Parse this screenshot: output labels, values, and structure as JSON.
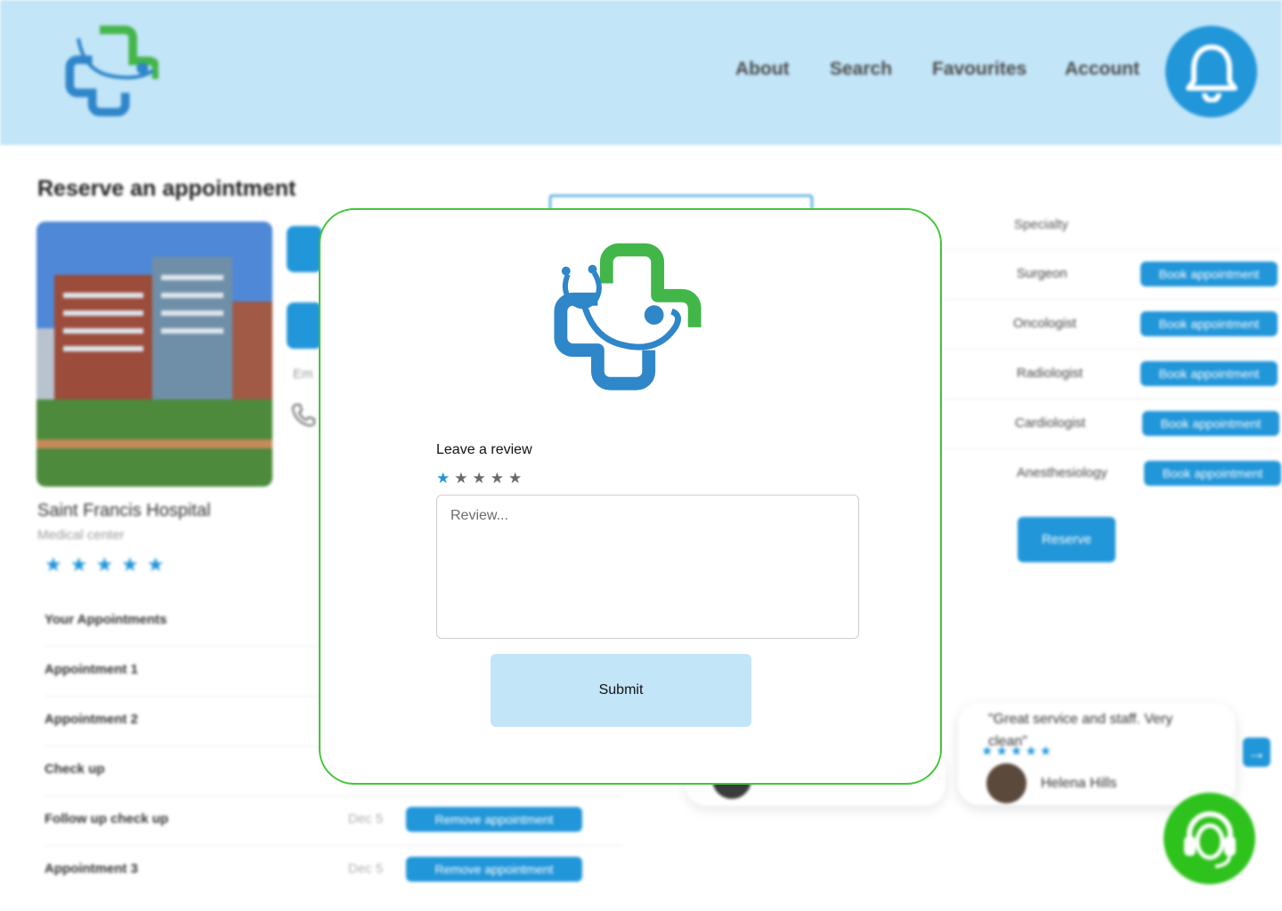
{
  "nav": {
    "links": [
      "About",
      "Search",
      "Favourites",
      "Account"
    ]
  },
  "page": {
    "title": "Reserve an appointment"
  },
  "hospital": {
    "name": "Saint Francis Hospital",
    "type": "Medical center",
    "rating": 4.5,
    "stars": "★★★★★"
  },
  "appointments": {
    "header": "Your Appointments",
    "rows": [
      {
        "label": "Appointment 1",
        "date": "",
        "action": ""
      },
      {
        "label": "Appointment 2",
        "date": "",
        "action": ""
      },
      {
        "label": "Check up",
        "date": "",
        "action": ""
      },
      {
        "label": "Follow up check up",
        "date": "Dec 5",
        "action": "Remove appointment"
      },
      {
        "label": "Appointment 3",
        "date": "Dec 5",
        "action": "Remove appointment"
      }
    ]
  },
  "contact": {
    "email_label": "Em"
  },
  "specialties": {
    "header": "Specialty",
    "rows": [
      {
        "label": "Surgeon",
        "action": "Book appointment"
      },
      {
        "label": "Oncologist",
        "action": "Book appointment"
      },
      {
        "label": "Radiologist",
        "action": "Book appointment"
      },
      {
        "label": "Cardiologist",
        "action": "Book appointment"
      },
      {
        "label": "Anesthesiology",
        "action": "Book appointment"
      }
    ],
    "reserve_label": "Reserve"
  },
  "testimonial": {
    "quote": "\"Great service and staff. Very clean\"",
    "stars": "★★★★★",
    "author": "Helena Hills"
  },
  "modal": {
    "review_label": "Leave a review",
    "rating": 1,
    "rating_max": 5,
    "review_placeholder": "Review...",
    "submit_label": "Submit"
  },
  "colors": {
    "brand_blue": "#2196d9",
    "header_bg": "#c2e5f8",
    "brand_green": "#43c63a",
    "support_green": "#2ec21c"
  },
  "icons": [
    "logo-icon",
    "bell-icon",
    "phone-icon",
    "star-icon",
    "arrow-right-icon",
    "headset-icon"
  ]
}
